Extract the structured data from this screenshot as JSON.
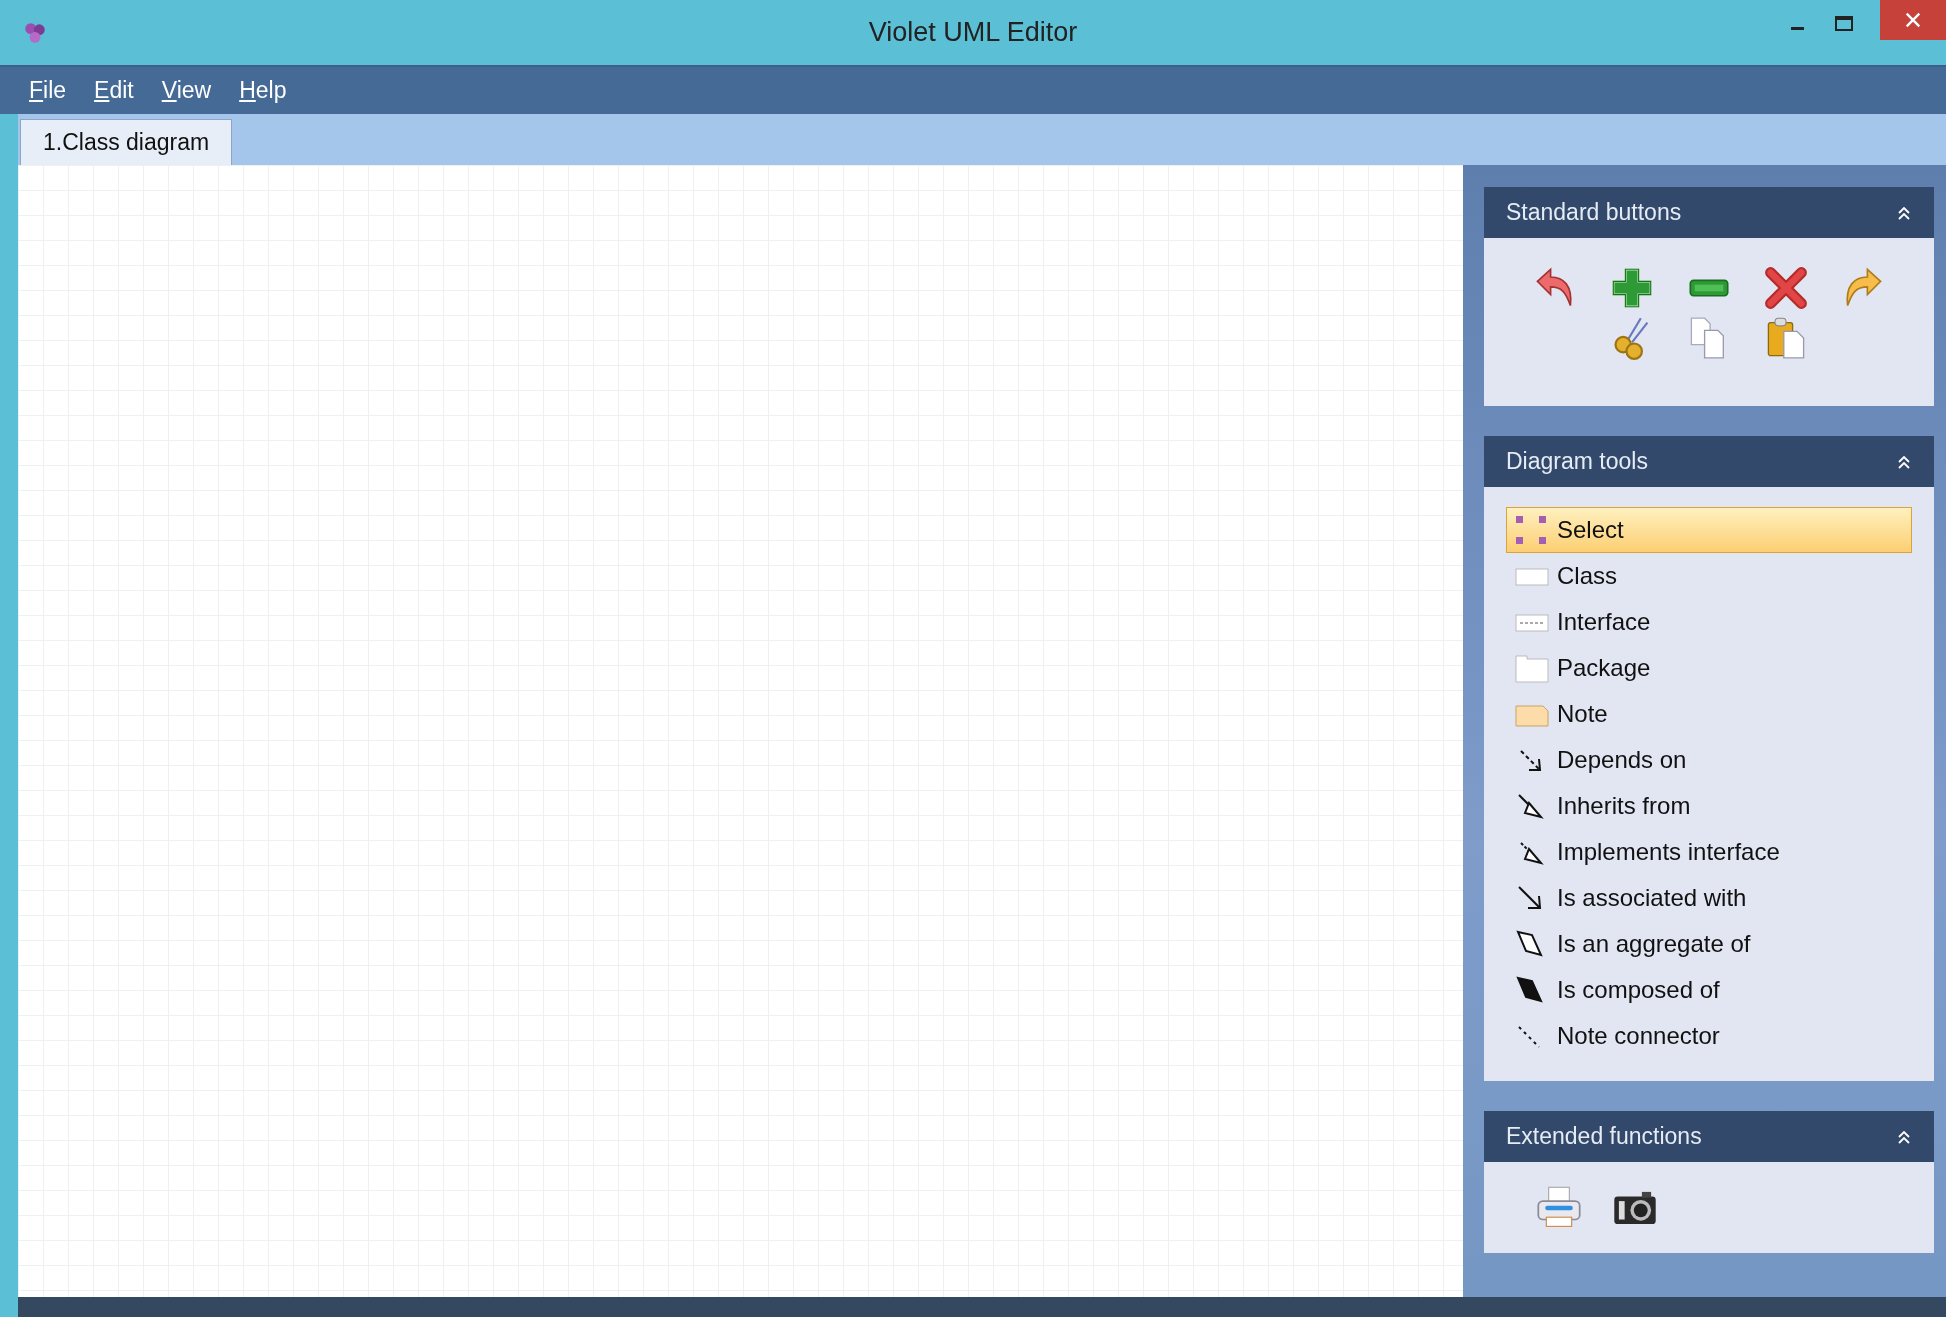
{
  "window": {
    "title": "Violet UML Editor"
  },
  "menu": [
    "File",
    "Edit",
    "View",
    "Help"
  ],
  "tabs": [
    {
      "label": "1.Class diagram",
      "selected": true
    }
  ],
  "standard_buttons": {
    "title": "Standard buttons"
  },
  "diagram_tools": {
    "title": "Diagram tools",
    "tools": [
      {
        "label": "Select",
        "kind": "select",
        "selected": true
      },
      {
        "label": "Class",
        "kind": "class",
        "selected": false
      },
      {
        "label": "Interface",
        "kind": "interface",
        "selected": false
      },
      {
        "label": "Package",
        "kind": "package",
        "selected": false
      },
      {
        "label": "Note",
        "kind": "note",
        "selected": false
      },
      {
        "label": "Depends on",
        "kind": "dependency",
        "selected": false
      },
      {
        "label": "Inherits from",
        "kind": "inheritance",
        "selected": false
      },
      {
        "label": "Implements interface",
        "kind": "implementation",
        "selected": false
      },
      {
        "label": "Is associated with",
        "kind": "association",
        "selected": false
      },
      {
        "label": "Is an aggregate of",
        "kind": "aggregation",
        "selected": false
      },
      {
        "label": "Is composed of",
        "kind": "composition",
        "selected": false
      },
      {
        "label": "Note connector",
        "kind": "note_connector",
        "selected": false
      }
    ]
  },
  "extended_functions": {
    "title": "Extended functions"
  }
}
